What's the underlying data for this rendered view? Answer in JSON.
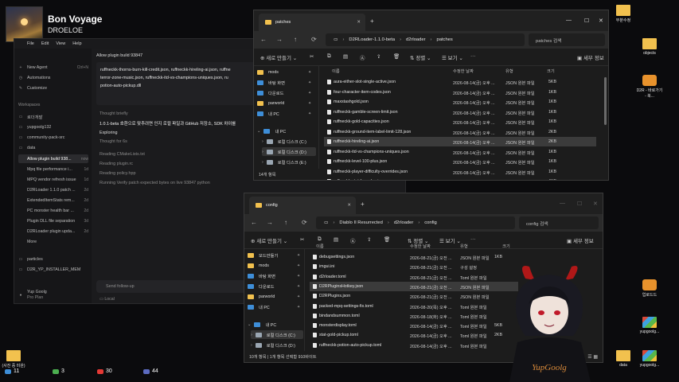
{
  "music": {
    "title": "Bon Voyage",
    "artist": "DROELOE"
  },
  "editor": {
    "menu": [
      "File",
      "Edit",
      "View",
      "Help"
    ],
    "sidebar": {
      "top": [
        {
          "icon": "+",
          "label": "New Agent",
          "shortcut": "Ctrl+N"
        },
        {
          "icon": "◷",
          "label": "Automations"
        },
        {
          "icon": "✎",
          "label": "Customize"
        }
      ],
      "workspaces_label": "Workspaces",
      "workspaces": [
        {
          "label": "로더개발"
        },
        {
          "label": "yupgoolg132"
        },
        {
          "label": "community-pack-src"
        },
        {
          "label": "data"
        }
      ],
      "threads": [
        {
          "label": "Allow plugin build 938...",
          "time": "now",
          "active": true
        },
        {
          "label": "Mpq file performance i...",
          "time": "1d"
        },
        {
          "label": "MPQ vendor refresh issue",
          "time": "1d"
        },
        {
          "label": "D2RLoader 1.1.0 patch ...",
          "time": "2d"
        },
        {
          "label": "ExtendedItemStats rem...",
          "time": "2d"
        },
        {
          "label": "PC monster health bar ...",
          "time": "2d"
        },
        {
          "label": "Plugin DLL file separation",
          "time": "3d"
        },
        {
          "label": "D2RLoader plugin upda...",
          "time": "2d"
        },
        {
          "label": "More",
          "time": ""
        }
      ],
      "bottom": [
        {
          "label": "particles"
        },
        {
          "label": "D2R_YP_INSTALLER_MEM"
        }
      ],
      "user": {
        "name": "Yup Goolg",
        "plan": "Pro Plan"
      }
    },
    "main": {
      "title": "Allow plugin build 93847",
      "code_lines": [
        "ruffneckk-thorns-burn-kill-credit.json, ruffneckk-hireling-ai.json, ruffne",
        "terror-zone-music.json, ruffneckk-itd-vs-champions-uniques.json, ru",
        "potion-auto-pickup.dll"
      ],
      "thought": "Thought briefly",
      "result": "1.0.1-beta 호환으로 맞추려면 인지 로컬 파일과 GitHub 저장소, SDK 차이를",
      "exploring": "Exploring",
      "thought2": "Thought for 6s",
      "reading": [
        "Reading CMakeLists.txt",
        "Reading plugin.rc",
        "Reading policy.hpp"
      ],
      "running": "Running Verify patch expected bytes on live 93847 python",
      "followup_placeholder": "Send follow-up",
      "local_label": "Local"
    }
  },
  "win1": {
    "tab": "patches",
    "breadcrumb": [
      "D2RLoader-1.1.0-beta",
      "d2rloader",
      "patches"
    ],
    "search_placeholder": "patches 검색",
    "toolbar": {
      "new": "새로 만들기",
      "sort": "정렬",
      "view": "보기",
      "details": "세부 정보"
    },
    "nav": [
      {
        "label": "mods",
        "pin": true
      },
      {
        "label": "바탕 화면",
        "pin": true,
        "color": "blue"
      },
      {
        "label": "다운로드",
        "pin": true,
        "color": "blue"
      },
      {
        "label": "parworld",
        "pin": true
      },
      {
        "label": "내 PC",
        "pin": true,
        "color": "blue"
      },
      {
        "label": "내 PC",
        "expand": true,
        "color": "blue"
      },
      {
        "label": "로컬 디스크 (C:)",
        "drive": true
      },
      {
        "label": "로컬 디스크 (D:)",
        "drive": true,
        "sel": true
      },
      {
        "label": "로컬 디스크 (E:)",
        "drive": true
      }
    ],
    "columns": [
      "이름",
      "수정한 날짜",
      "유형",
      "크기"
    ],
    "files": [
      {
        "name": "aura-either-slot-single-active.json",
        "date": "2026-08-14(금) 오후 ...",
        "type": "JSON 원본 파일",
        "size": "5KB"
      },
      {
        "name": "four-character-item-codes.json",
        "date": "2026-08-14(금) 오후 ...",
        "type": "JSON 원본 파일",
        "size": "1KB"
      },
      {
        "name": "maxstashgold.json",
        "date": "2026-08-14(금) 오후 ...",
        "type": "JSON 원본 파일",
        "size": "1KB"
      },
      {
        "name": "ruffneckk-gamble-screen-limit.json",
        "date": "2026-08-14(금) 오후 ...",
        "type": "JSON 원본 파일",
        "size": "1KB"
      },
      {
        "name": "ruffneckk-gold-capacities.json",
        "date": "2026-08-14(금) 오후 ...",
        "type": "JSON 원본 파일",
        "size": "1KB"
      },
      {
        "name": "ruffneckk-ground-item-label-limit-128.json",
        "date": "2026-08-14(금) 오후 ...",
        "type": "JSON 원본 파일",
        "size": "2KB"
      },
      {
        "name": "ruffneckk-hireling-ai.json",
        "date": "2026-08-14(금) 오후 ...",
        "type": "JSON 원본 파일",
        "size": "2KB",
        "sel": true
      },
      {
        "name": "ruffneckk-itd-vs-champions-uniques.json",
        "date": "2026-08-14(금) 오후 ...",
        "type": "JSON 원본 파일",
        "size": "1KB"
      },
      {
        "name": "ruffneckk-level-100-plus.json",
        "date": "2026-08-14(금) 오후 ...",
        "type": "JSON 원본 파일",
        "size": "1KB"
      },
      {
        "name": "ruffneckk-player-difficulty-overrides.json",
        "date": "2026-08-14(금) 오후 ...",
        "type": "JSON 원본 파일",
        "size": "1KB"
      },
      {
        "name": "ruffneckk-stat-formulas.json",
        "date": "2026-08-14(금) 오후 ...",
        "type": "JSON 원본 파일",
        "size": "4KB"
      }
    ],
    "status": "14개 항목"
  },
  "win2": {
    "tab": "config",
    "breadcrumb": [
      "Diablo II Resurrected",
      "d2rloader",
      "config"
    ],
    "search_placeholder": "config 검색",
    "toolbar": {
      "new": "새로 만들기",
      "sort": "정렬",
      "view": "보기",
      "details": "세부 정보"
    },
    "nav": [
      {
        "label": "모드만들기",
        "pin": true
      },
      {
        "label": "mods",
        "pin": true
      },
      {
        "label": "바탕 화면",
        "pin": true,
        "color": "blue"
      },
      {
        "label": "다운로드",
        "pin": true,
        "color": "blue"
      },
      {
        "label": "parworld",
        "pin": true
      },
      {
        "label": "내 PC",
        "pin": true,
        "color": "blue"
      },
      {
        "label": "내 PC",
        "expand": true,
        "color": "blue"
      },
      {
        "label": "로컬 디스크 (C:)",
        "drive": true,
        "sel": true
      },
      {
        "label": "로컬 디스크 (D:)",
        "drive": true
      }
    ],
    "columns": [
      "이름",
      "수정한 날짜",
      "유형",
      "크기"
    ],
    "files": [
      {
        "name": "debugsettings.json",
        "date": "2026-08-21(금) 오전 ...",
        "type": "JSON 원본 파일",
        "size": "1KB"
      },
      {
        "name": "imgui.ini",
        "date": "2026-08-21(금) 오전 ...",
        "type": "구성 설정",
        "size": ""
      },
      {
        "name": "d2rloader.toml",
        "date": "2026-08-21(금) 오전 ...",
        "type": "Toml 원본 파일",
        "size": ""
      },
      {
        "name": "D2RPluginsHotkey.json",
        "date": "2026-08-21(금) 오전 ...",
        "type": "JSON 원본 파일",
        "size": "",
        "sel": true
      },
      {
        "name": "D2RPlugins.json",
        "date": "2026-08-21(금) 오전 ...",
        "type": "JSON 원본 파일",
        "size": ""
      },
      {
        "name": "packed-mpq-settings-fix.toml",
        "date": "2026-08-20(목) 오후 ...",
        "type": "Toml 원본 파일",
        "size": ""
      },
      {
        "name": "bindandsummon.toml",
        "date": "2026-08-18(화) 오후 ...",
        "type": "Toml 원본 파일",
        "size": ""
      },
      {
        "name": "monsterdisplay.toml",
        "date": "2026-08-14(금) 오후 ...",
        "type": "Toml 원본 파일",
        "size": "5KB"
      },
      {
        "name": "stat-gold-pickup.toml",
        "date": "2026-08-14(금) 오후 ...",
        "type": "Toml 원본 파일",
        "size": "2KB"
      },
      {
        "name": "ruffneckk-potion-auto-pickup.toml",
        "date": "2026-08-14(금) 오후 ...",
        "type": "Toml 원본 파일",
        "size": ""
      }
    ],
    "status": "10개 항목   |   1개 항목 선택함 910바이트"
  },
  "desktop": {
    "left_icon": "(사진 중 미완)",
    "right_icons": [
      {
        "label": "부분수정",
        "kind": "folder"
      },
      {
        "label": "objects",
        "kind": "folder"
      },
      {
        "label": "D2R - 바로가기 - 복...",
        "kind": "d2r"
      },
      {
        "label": "업로드드",
        "kind": "app"
      },
      {
        "label": "yupgoolg...",
        "kind": "box"
      },
      {
        "label": "data",
        "kind": "folder"
      },
      {
        "label": "yupgoolg...",
        "kind": "box"
      }
    ]
  },
  "taskbar": [
    {
      "label": "11",
      "color": "#3e8ed8"
    },
    {
      "label": "3",
      "color": "#4caf50"
    },
    {
      "label": "30",
      "color": "#e53935"
    },
    {
      "label": "44",
      "color": "#5c6bc0"
    }
  ]
}
